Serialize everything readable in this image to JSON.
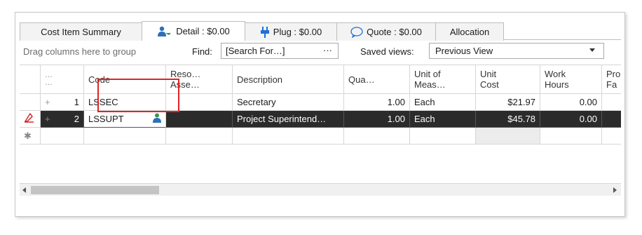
{
  "tabs": [
    {
      "label": "Cost Item Summary"
    },
    {
      "label": "Detail : $0.00"
    },
    {
      "label": "Plug : $0.00"
    },
    {
      "label": "Quote : $0.00"
    },
    {
      "label": "Allocation"
    }
  ],
  "toolbar": {
    "drag_hint": "Drag columns here to group",
    "find_label": "Find:",
    "find_value": "[Search For…]",
    "find_button": "···",
    "saved_label": "Saved views:",
    "saved_value": "Previous View"
  },
  "columns": [
    "…\n…",
    "Code",
    "Reso…\nAsse…",
    "Description",
    "Qua…",
    "Unit of\nMeas…",
    "Unit\nCost",
    "Work\nHours",
    "Pro\nFa"
  ],
  "rows": [
    {
      "num": "1",
      "code": "LSSEC",
      "description": "Secretary",
      "quantity": "1.00",
      "unit": "Each",
      "unit_cost": "$21.97",
      "work_hours": "0.00"
    },
    {
      "num": "2",
      "code": "LSSUPT",
      "description": "Project Superintend…",
      "quantity": "1.00",
      "unit": "Each",
      "unit_cost": "$45.78",
      "work_hours": "0.00"
    }
  ],
  "new_row_marker": "✱",
  "colors": {
    "selected_row": "#2b2b2b",
    "highlight": "#e02424",
    "icon_blue": "#1f6fd6",
    "icon_green": "#2e9b4f"
  }
}
